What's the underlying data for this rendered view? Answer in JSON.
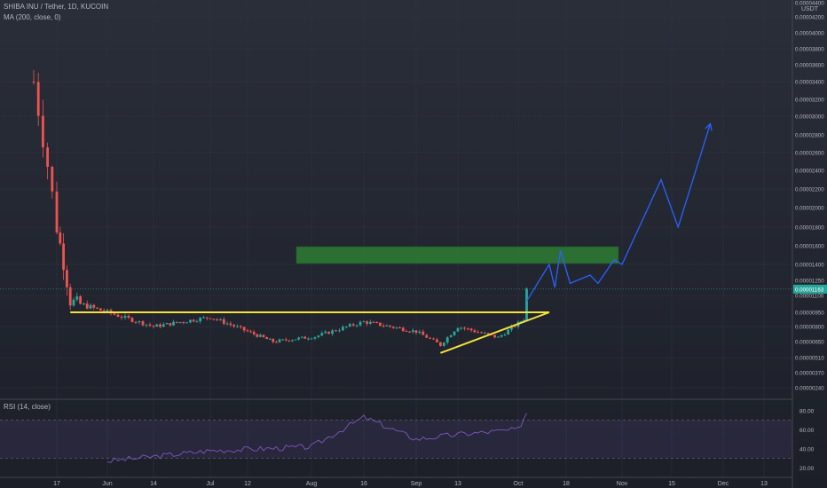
{
  "header": {
    "symbol_line": "SHIBA INU / Tether, 1D, KUCOIN",
    "ma_line": "MA (200, close, 0)",
    "rsi_line": "RSI (14, close)"
  },
  "price_axis": {
    "currency": "USDT",
    "current_price_label": "0.00001163",
    "labels": [
      "0.00004400",
      "0.00004200",
      "0.00004000",
      "0.00003800",
      "0.00003600",
      "0.00003400",
      "0.00003200",
      "0.00003000",
      "0.00002800",
      "0.00002600",
      "0.00002400",
      "0.00002200",
      "0.00002000",
      "0.00001800",
      "0.00001600",
      "0.00001400",
      "0.00001250",
      "0.00001100",
      "0.00000950",
      "0.00000800",
      "0.00000650",
      "0.00000510",
      "0.00000370",
      "0.00000240"
    ]
  },
  "rsi_axis": {
    "labels": [
      "80.00",
      "60.00",
      "40.00",
      "20.00"
    ]
  },
  "time_axis": {
    "labels": [
      "17",
      "Jun",
      "14",
      "Jul",
      "12",
      "Aug",
      "16",
      "Sep",
      "13",
      "Oct",
      "18",
      "Nov",
      "15",
      "Dec",
      "13"
    ]
  },
  "colors": {
    "up": "#26a69a",
    "down": "#ef5350",
    "trendline": "#f5e13b",
    "projection": "#2962ff",
    "zone": "#2e7d32",
    "rsi_line": "#7e57c2"
  },
  "chart_data": {
    "type": "candlestick",
    "title": "SHIBA INU / Tether, 1D, KUCOIN",
    "y_axis": {
      "min": 2.4e-06,
      "max": 4.4e-05,
      "unit": "USDT"
    },
    "last_price": 1.163e-05,
    "x_axis_ticks": [
      "17",
      "Jun",
      "14",
      "Jul",
      "12",
      "Aug",
      "16",
      "Sep",
      "13",
      "Oct",
      "18",
      "Nov",
      "15",
      "Dec",
      "13"
    ],
    "approx_close_path": [
      {
        "t": "May 12",
        "close": 3.4e-05
      },
      {
        "t": "May 14",
        "close": 2.8e-05
      },
      {
        "t": "May 17",
        "close": 1.8e-05
      },
      {
        "t": "May 21",
        "close": 1.05e-05
      },
      {
        "t": "Jun 1",
        "close": 9.5e-06
      },
      {
        "t": "Jun 14",
        "close": 8e-06
      },
      {
        "t": "Jul 1",
        "close": 9e-06
      },
      {
        "t": "Jul 12",
        "close": 7.5e-06
      },
      {
        "t": "Jul 20",
        "close": 6.5e-06
      },
      {
        "t": "Aug 2",
        "close": 7e-06
      },
      {
        "t": "Aug 16",
        "close": 8.5e-06
      },
      {
        "t": "Sep 1",
        "close": 7.5e-06
      },
      {
        "t": "Sep 8",
        "close": 6.2e-06
      },
      {
        "t": "Sep 13",
        "close": 8e-06
      },
      {
        "t": "Sep 25",
        "close": 6.9e-06
      },
      {
        "t": "Oct 3",
        "close": 8.8e-06
      },
      {
        "t": "Oct 4",
        "close": 1.163e-05
      }
    ],
    "annotations": {
      "resistance_level": 9.5e-06,
      "rising_support_from": {
        "t": "Sep 8",
        "price": 5.5e-06
      },
      "rising_support_to": {
        "t": "Oct 12",
        "price": 9.5e-06
      },
      "target_zone": {
        "from": 1.41e-05,
        "to": 1.59e-05
      },
      "projection_path": [
        {
          "t": "Oct 4",
          "price": 1.05e-05
        },
        {
          "t": "Oct 12",
          "price": 1.4e-05
        },
        {
          "t": "Oct 14",
          "price": 1.18e-05
        },
        {
          "t": "Oct 16",
          "price": 1.55e-05
        },
        {
          "t": "Oct 19",
          "price": 1.22e-05
        },
        {
          "t": "Oct 24",
          "price": 1.3e-05
        },
        {
          "t": "Oct 26",
          "price": 1.22e-05
        },
        {
          "t": "Oct 30",
          "price": 1.45e-05
        },
        {
          "t": "Nov 1",
          "price": 1.4e-05
        },
        {
          "t": "Nov 12",
          "price": 2.3e-05
        },
        {
          "t": "Nov 17",
          "price": 1.8e-05
        },
        {
          "t": "Nov 27",
          "price": 2.92e-05
        }
      ]
    },
    "rsi": {
      "period": 14,
      "range": [
        0,
        100
      ],
      "upper_band": 70,
      "lower_band": 30,
      "approx_values": [
        {
          "t": "Jun 1",
          "value": 27
        },
        {
          "t": "Jul 1",
          "value": 38
        },
        {
          "t": "Aug 1",
          "value": 42
        },
        {
          "t": "Aug 16",
          "value": 73
        },
        {
          "t": "Sep 1",
          "value": 50
        },
        {
          "t": "Sep 13",
          "value": 55
        },
        {
          "t": "Oct 1",
          "value": 60
        },
        {
          "t": "Oct 4",
          "value": 78
        }
      ]
    }
  }
}
